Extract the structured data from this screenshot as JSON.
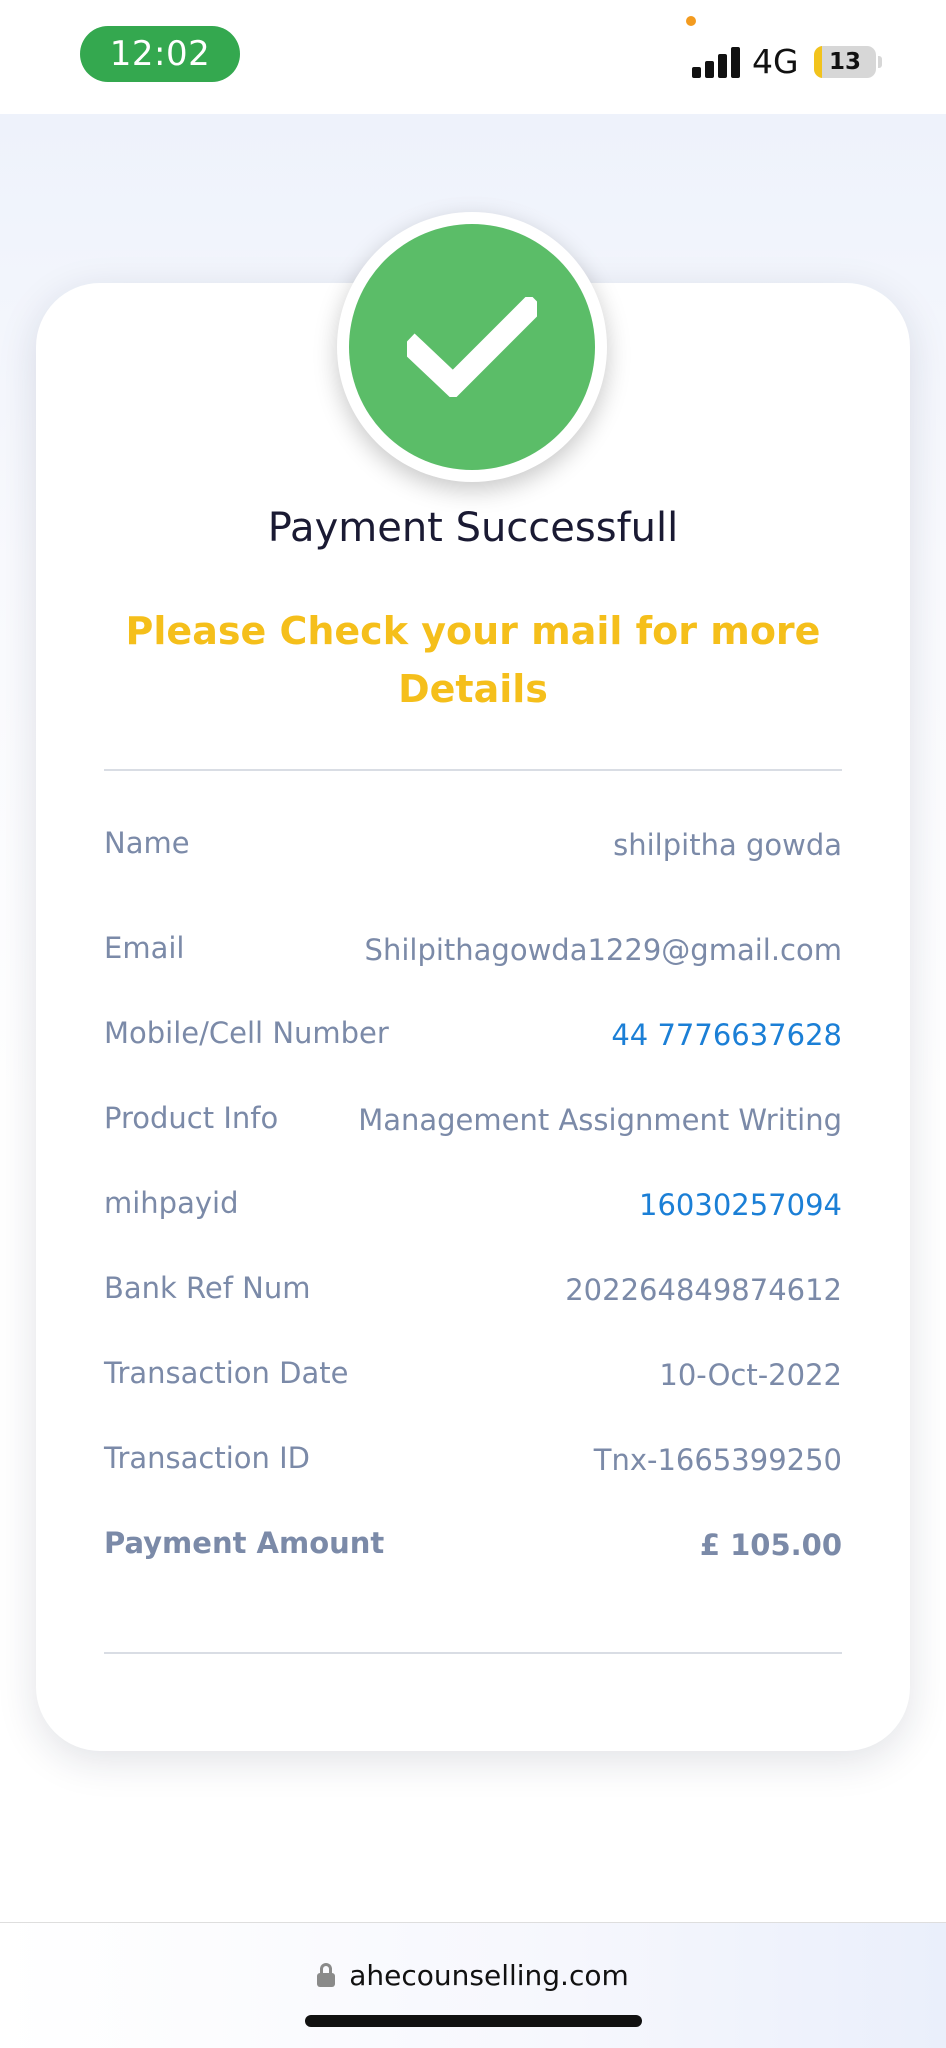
{
  "status_bar": {
    "time": "12:02",
    "network": "4G",
    "battery": "13",
    "battery_percent": 13
  },
  "payment": {
    "title": "Payment Successfull",
    "subtitle": "Please Check your mail for more Details",
    "icon": "check-icon",
    "colors": {
      "success": "#5bbd68",
      "subtitle": "#f5bf1b",
      "link": "#1b7fd6",
      "label": "#7b8aa8"
    },
    "rows": [
      {
        "label": "Name",
        "value": "shilpitha gowda"
      },
      {
        "label": "Email",
        "value": "Shilpithagowda1229@gmail.com"
      },
      {
        "label": "Mobile/Cell Number",
        "value": "44 7776637628"
      },
      {
        "label": "Product Info",
        "value": "Management Assignment Writing"
      },
      {
        "label": "mihpayid",
        "value": "16030257094"
      },
      {
        "label": "Bank Ref Num",
        "value": "202264849874612"
      },
      {
        "label": "Transaction Date",
        "value": "10-Oct-2022"
      },
      {
        "label": "Transaction ID",
        "value": "Tnx-1665399250"
      },
      {
        "label": "Payment Amount",
        "value": "£ 105.00"
      }
    ]
  },
  "browser": {
    "url": "ahecounselling.com",
    "lock_icon": "lock-icon"
  }
}
